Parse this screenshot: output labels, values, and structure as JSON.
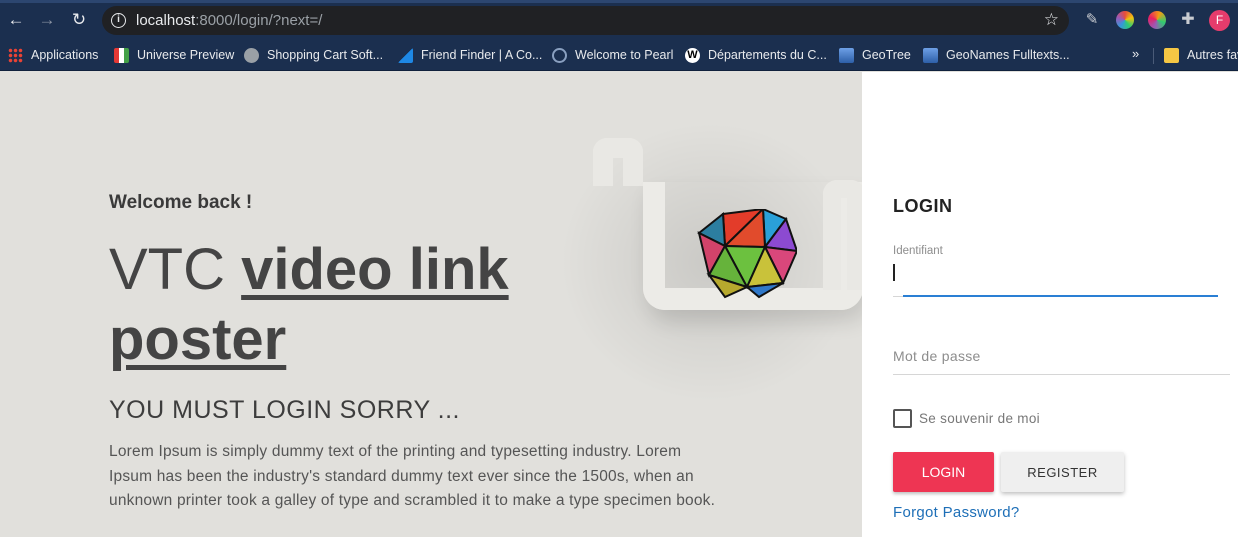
{
  "browser": {
    "url_host": "localhost",
    "url_rest": ":8000/login/?next=/",
    "avatar_letter": "F",
    "bookmarks": [
      {
        "label": "Applications",
        "icon": "apps-grid-icon",
        "color": "#ea4335"
      },
      {
        "label": "Universe Preview",
        "icon": "universe-icon",
        "color": "#ffffff"
      },
      {
        "label": "Shopping Cart Soft...",
        "icon": "globe-icon",
        "color": "#9aa0a6"
      },
      {
        "label": "Friend Finder | A Co...",
        "icon": "triangle-icon",
        "color": "#1e88e5"
      },
      {
        "label": "Welcome to Pearl",
        "icon": "pearl-icon",
        "color": "#2c3e50"
      },
      {
        "label": "Départements du C...",
        "icon": "wikipedia-icon",
        "color": "#ffffff"
      },
      {
        "label": "GeoTree",
        "icon": "geotree-icon",
        "color": "#5b8fd9"
      },
      {
        "label": "GeoNames Fulltexts...",
        "icon": "geonames-icon",
        "color": "#5b8fd9"
      },
      {
        "label": "Autres favoris",
        "icon": "folder-icon",
        "color": "#f6c744"
      }
    ],
    "bookmarks_more": "»"
  },
  "hero": {
    "welcome": "Welcome back !",
    "title_thin": "VTC",
    "title_bold": "video link poster",
    "subtitle": "YOU MUST LOGIN SORRY ...",
    "description": "Lorem Ipsum is simply dummy text of the printing and typesetting industry. Lorem Ipsum has been the industry's standard dummy text ever since the 1500s, when an unknown printer took a galley of type and scrambled it to make a type specimen book."
  },
  "login": {
    "title": "LOGIN",
    "identifiant_label": "Identifiant",
    "identifiant_value": "",
    "password_placeholder": "Mot de passe",
    "remember_label": "Se souvenir de moi",
    "login_button": "LOGIN",
    "register_button": "REGISTER",
    "forgot_link": "Forgot Password?"
  },
  "colors": {
    "accent": "#ee3553",
    "link": "#1e6fb7",
    "focus": "#2a7fd4",
    "chrome": "#1b2f4f"
  }
}
